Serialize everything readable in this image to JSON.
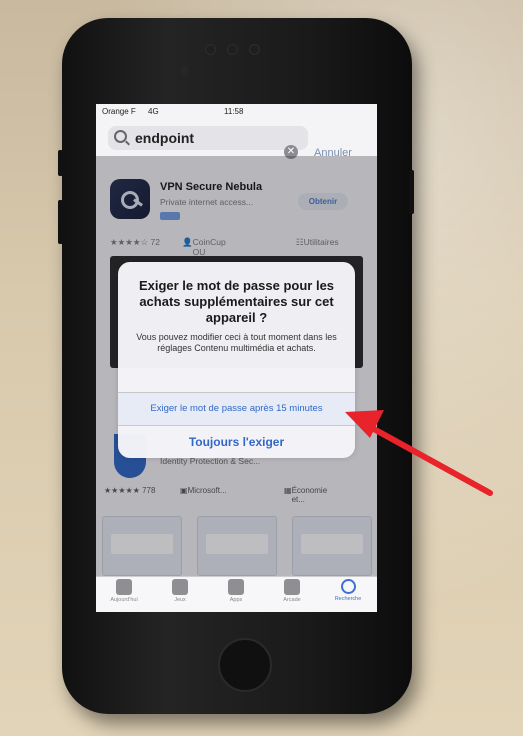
{
  "status": {
    "carrier": "Orange F",
    "network": "4G",
    "time": "11:58"
  },
  "search": {
    "query": "endpoint",
    "cancel_label": "Annuler"
  },
  "app1": {
    "name": "VPN Secure Nebula",
    "subtitle": "Private internet access...",
    "get_label": "Obtenir",
    "rating": "★★★★☆ 72",
    "developer": "CoinCup OU",
    "category": "Utilitaires"
  },
  "app2": {
    "subtitle": "Identity Protection & Sec...",
    "rating": "★★★★★ 778",
    "developer": "Microsoft...",
    "category": "Économie et..."
  },
  "tabbar": {
    "items": [
      {
        "label": "Aujourd'hui",
        "icon": "today-icon"
      },
      {
        "label": "Jeux",
        "icon": "rocket-icon"
      },
      {
        "label": "Apps",
        "icon": "apps-stack-icon"
      },
      {
        "label": "Arcade",
        "icon": "arcade-icon"
      },
      {
        "label": "Recherche",
        "icon": "search-icon"
      }
    ]
  },
  "alert": {
    "title": "Exiger le mot de passe pour les achats supplémentaires sur cet appareil ?",
    "message": "Vous pouvez modifier ceci à tout moment dans les réglages Contenu multimédia et achats.",
    "option_15min": "Exiger le mot de passe après 15 minutes",
    "option_always": "Toujours l'exiger"
  },
  "annotation": {
    "arrow_color": "#e8232a"
  }
}
